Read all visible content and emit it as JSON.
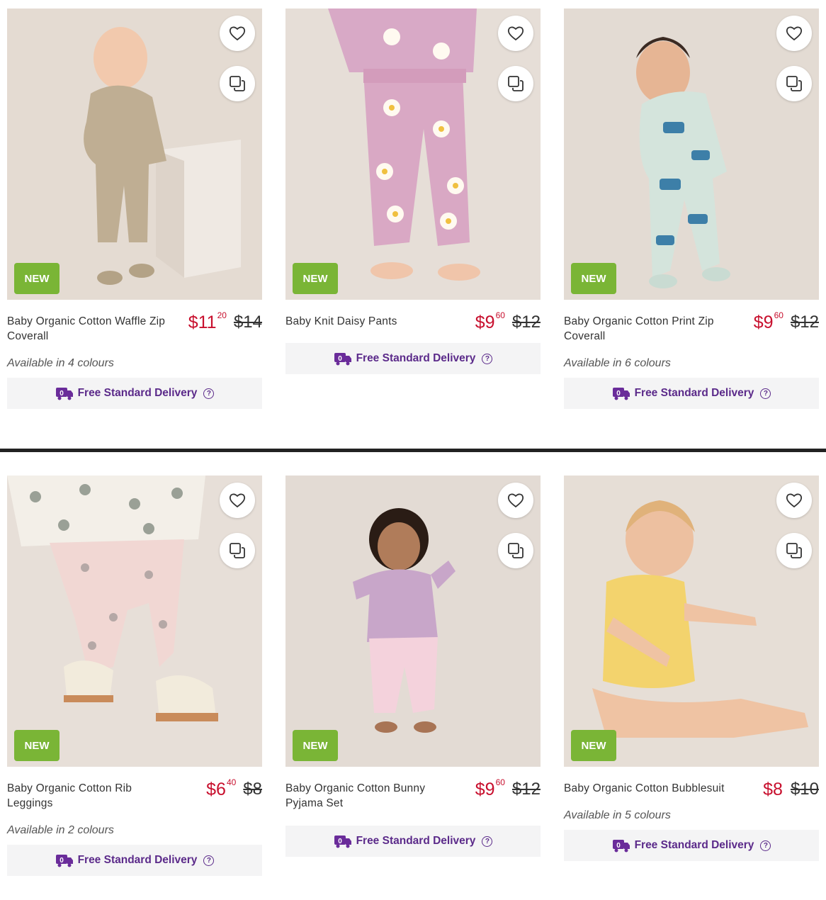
{
  "colors": {
    "price": "#c8102e",
    "badge": "#7ab536",
    "delivery_text": "#5b2a8a"
  },
  "icons": {
    "wishlist": "heart-icon",
    "compare": "compare-icon",
    "delivery": "delivery-truck-icon",
    "help": "help-circle-icon"
  },
  "products": [
    {
      "name": "Baby Organic Cotton Waffle Zip Coverall",
      "badge": "NEW",
      "price_dollars": "$11",
      "price_cents": "20",
      "was_price": "$14",
      "availability": "Available in 4 colours",
      "delivery": "Free Standard Delivery",
      "help": "?"
    },
    {
      "name": "Baby Knit Daisy Pants",
      "badge": "NEW",
      "price_dollars": "$9",
      "price_cents": "60",
      "was_price": "$12",
      "availability": "",
      "delivery": "Free Standard Delivery",
      "help": "?"
    },
    {
      "name": "Baby Organic Cotton Print Zip Coverall",
      "badge": "NEW",
      "price_dollars": "$9",
      "price_cents": "60",
      "was_price": "$12",
      "availability": "Available in 6 colours",
      "delivery": "Free Standard Delivery",
      "help": "?"
    },
    {
      "name": "Baby Organic Cotton Rib Leggings",
      "badge": "NEW",
      "price_dollars": "$6",
      "price_cents": "40",
      "was_price": "$8",
      "availability": "Available in 2 colours",
      "delivery": "Free Standard Delivery",
      "help": "?"
    },
    {
      "name": "Baby Organic Cotton Bunny Pyjama Set",
      "badge": "NEW",
      "price_dollars": "$9",
      "price_cents": "60",
      "was_price": "$12",
      "availability": "",
      "delivery": "Free Standard Delivery",
      "help": "?"
    },
    {
      "name": "Baby Organic Cotton Bubblesuit",
      "badge": "NEW",
      "price_dollars": "$8",
      "price_cents": "",
      "was_price": "$10",
      "availability": "Available in 5 colours",
      "delivery": "Free Standard Delivery",
      "help": "?"
    }
  ]
}
